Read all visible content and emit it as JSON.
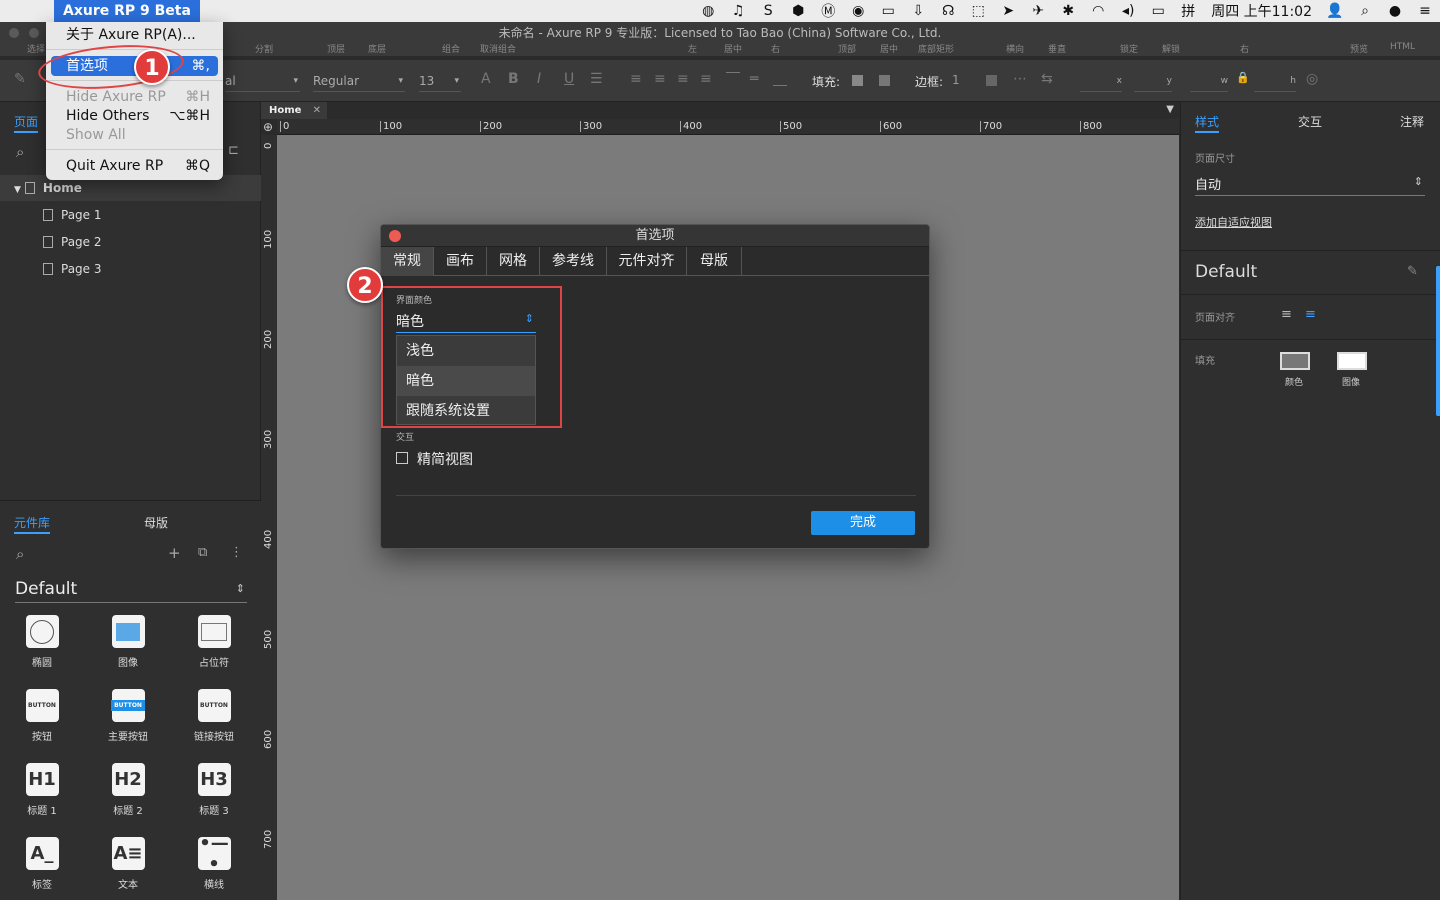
{
  "menubar": {
    "app_name": "Axure RP 9 Beta",
    "clock": "周四 上午11:02"
  },
  "window": {
    "title": "未命名 - Axure RP 9 专业版：Licensed to Tao Bao (China) Software Co., Ltd."
  },
  "toolbar_labels": [
    "选择",
    "分割",
    "顶层",
    "底层",
    "组合",
    "取消组合",
    "左",
    "居中",
    "右",
    "顶部",
    "居中",
    "底部矩形",
    "横向",
    "垂直",
    "锁定",
    "解锁",
    "右",
    "预览",
    "HTML"
  ],
  "stylebar": {
    "font_family": "al",
    "font_weight": "Regular",
    "font_size": "13",
    "fill_label": "填充:",
    "border_label": "边框:",
    "border_value": "1",
    "x_label": "x",
    "y_label": "y",
    "w_label": "w",
    "h_label": "h"
  },
  "app_menu": {
    "items": [
      {
        "label": "关于 Axure RP(A)...",
        "shortcut": ""
      },
      {
        "label": "首选项",
        "shortcut": "⌘,"
      },
      {
        "label": "Hide Axure RP",
        "shortcut": "⌘H"
      },
      {
        "label": "Hide Others",
        "shortcut": "⌥⌘H"
      },
      {
        "label": "Show All",
        "shortcut": ""
      },
      {
        "label": "Quit Axure RP",
        "shortcut": "⌘Q"
      }
    ]
  },
  "annotations": {
    "marker1": "1",
    "marker2": "2"
  },
  "pages_panel": {
    "tab": "页面",
    "home": "Home",
    "pages": [
      "Page 1",
      "Page 2",
      "Page 3"
    ]
  },
  "library_panel": {
    "tab_widgets": "元件库",
    "tab_masters": "母版",
    "library": "Default",
    "widgets": [
      {
        "label": "椭圆",
        "icon": "ellipse-icon"
      },
      {
        "label": "图像",
        "icon": "image-icon"
      },
      {
        "label": "占位符",
        "icon": "placeholder-icon"
      },
      {
        "label": "按钮",
        "icon": "button-icon",
        "glyph": "BUTTON"
      },
      {
        "label": "主要按钮",
        "icon": "primary-button-icon",
        "glyph": "BUTTON"
      },
      {
        "label": "链接按钮",
        "icon": "link-button-icon",
        "glyph": "BUTTON"
      },
      {
        "label": "标题 1",
        "icon": "h1-icon",
        "glyph": "H1"
      },
      {
        "label": "标题 2",
        "icon": "h2-icon",
        "glyph": "H2"
      },
      {
        "label": "标题 3",
        "icon": "h3-icon",
        "glyph": "H3"
      },
      {
        "label": "标签",
        "icon": "label-icon",
        "glyph": "A_"
      },
      {
        "label": "文本",
        "icon": "text-icon",
        "glyph": "A≡"
      },
      {
        "label": "横线",
        "icon": "line-icon",
        "glyph": "•—•"
      }
    ]
  },
  "doc_tab": {
    "label": "Home"
  },
  "ruler": {
    "h_ticks": [
      "0",
      "100",
      "200",
      "300",
      "400",
      "500",
      "600",
      "700",
      "800"
    ],
    "v_ticks": [
      "0",
      "100",
      "200",
      "300",
      "400",
      "500",
      "600",
      "700"
    ]
  },
  "right_panel": {
    "tabs": [
      "样式",
      "交互",
      "注释"
    ],
    "page_size_label": "页面尺寸",
    "page_size_value": "自动",
    "adaptive_link": "添加自适应视图",
    "style_name": "Default",
    "align_label": "页面对齐",
    "fill_label": "填充",
    "fill_color": "颜色",
    "fill_image": "图像"
  },
  "dialog": {
    "title": "首选项",
    "tabs": [
      "常规",
      "画布",
      "网格",
      "参考线",
      "元件对齐",
      "母版"
    ],
    "ui_color_label": "界面颜色",
    "ui_color_value": "暗色",
    "options": [
      "浅色",
      "暗色",
      "跟随系统设置"
    ],
    "interaction_label": "交互",
    "compact_view_label": "精简视图",
    "done_button": "完成"
  },
  "colors": {
    "accent": "#1e8fe6",
    "menu_highlight": "#2a6fdb",
    "annotation_red": "#e04545"
  }
}
